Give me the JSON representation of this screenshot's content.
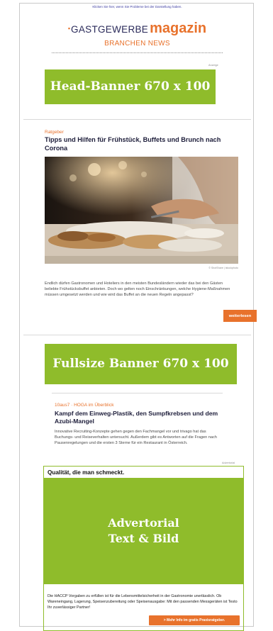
{
  "header": {
    "top_note": "Klicken Sie hier, wenn Sie Probleme bei der Darstellung haben.",
    "logo_bullet": "▪",
    "logo_part1": "GASTGEWERBE",
    "logo_part2": "magazin",
    "subtitle": "BRANCHEN NEWS"
  },
  "banner1": {
    "ad_label": "Anzeige",
    "text": "Head-Banner 670 x 100 px"
  },
  "article1": {
    "kicker": "Ratgeber",
    "title": "Tipps und Hilfen für Frühstück, Buffets und Brunch nach Corona",
    "image_credit": "© ShotShare | istockphoto",
    "body": "Endlich dürfen Gastronomen und Hoteliers in den meisten Bundesländern wieder das bei den Gästen beliebte Frühstücksbuffet anbieten. Doch wo gelten noch Einschränkungen, welche Hygiene-Maßnahmen müssen umgesetzt werden und wie wird das Buffet an die neuen Regeln angepasst?",
    "button": "weiterlesen"
  },
  "banner2": {
    "text": "Fullsize Banner 670 x 100 px"
  },
  "article2": {
    "kicker": "10aus7 · HOGA im Überblick",
    "title": "Kampf dem Einweg-Plastik, den Sumpfkrebsen und dem Azubi-Mangel",
    "body": "Innovative Recruiting-Konzepte gehen gegen den Fachmangel vor und trivago hat das Buchungs- und Reiseverhalten untersucht. Außerdem gibt es Antworten auf die Fragen nach Pausenregelungen und die ersten 3 Sterne für ein Restaurant in Österreich."
  },
  "advertorial": {
    "label": "Advertorial",
    "headline": "Qualität, die man schmeckt.",
    "placeholder_line1": "Advertorial",
    "placeholder_line2": "Text & Bild",
    "body": "Die HACCP Vorgaben zu erfüllen ist für die Lebensmittelsicherheit in der Gastronomie unerlässlich. Ob Wareneingang, Lagerung, Speisenzubereitung oder Speisenausgabe: Mit den passenden Messgeräten ist Testo Ihr zuverlässiger Partner!",
    "button": "> Mehr Info im gratis Praxisratgeber."
  },
  "colors": {
    "accent": "#e8722c",
    "banner_green": "#8fbc2b",
    "navy": "#1d1d3a"
  }
}
